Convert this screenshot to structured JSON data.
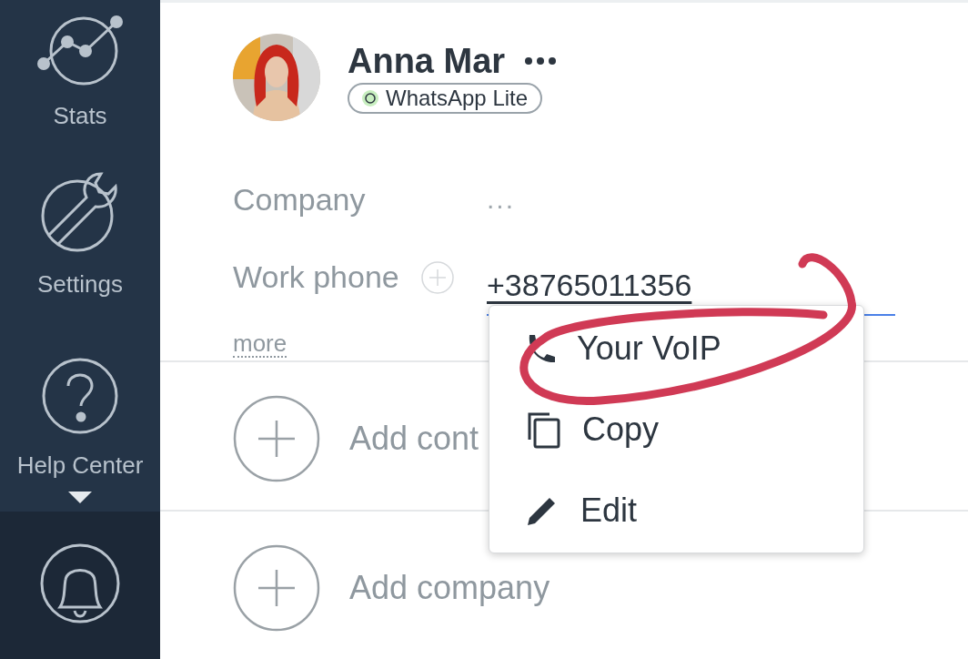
{
  "sidebar": {
    "items": [
      {
        "label": "Stats"
      },
      {
        "label": "Settings"
      },
      {
        "label": "Help Center",
        "expanded": false
      }
    ]
  },
  "contact": {
    "name": "Anna Mar",
    "channel": "WhatsApp Lite"
  },
  "fields": [
    {
      "label": "Company",
      "value": "...",
      "kind": "text"
    },
    {
      "label": "Work phone",
      "value": "+38765011356",
      "kind": "phone"
    }
  ],
  "more": "more",
  "actions": [
    {
      "label": "Add cont"
    },
    {
      "label": "Add company"
    }
  ],
  "context_menu": {
    "items": [
      {
        "label": "Your VoIP"
      },
      {
        "label": "Copy"
      },
      {
        "label": "Edit"
      }
    ]
  }
}
